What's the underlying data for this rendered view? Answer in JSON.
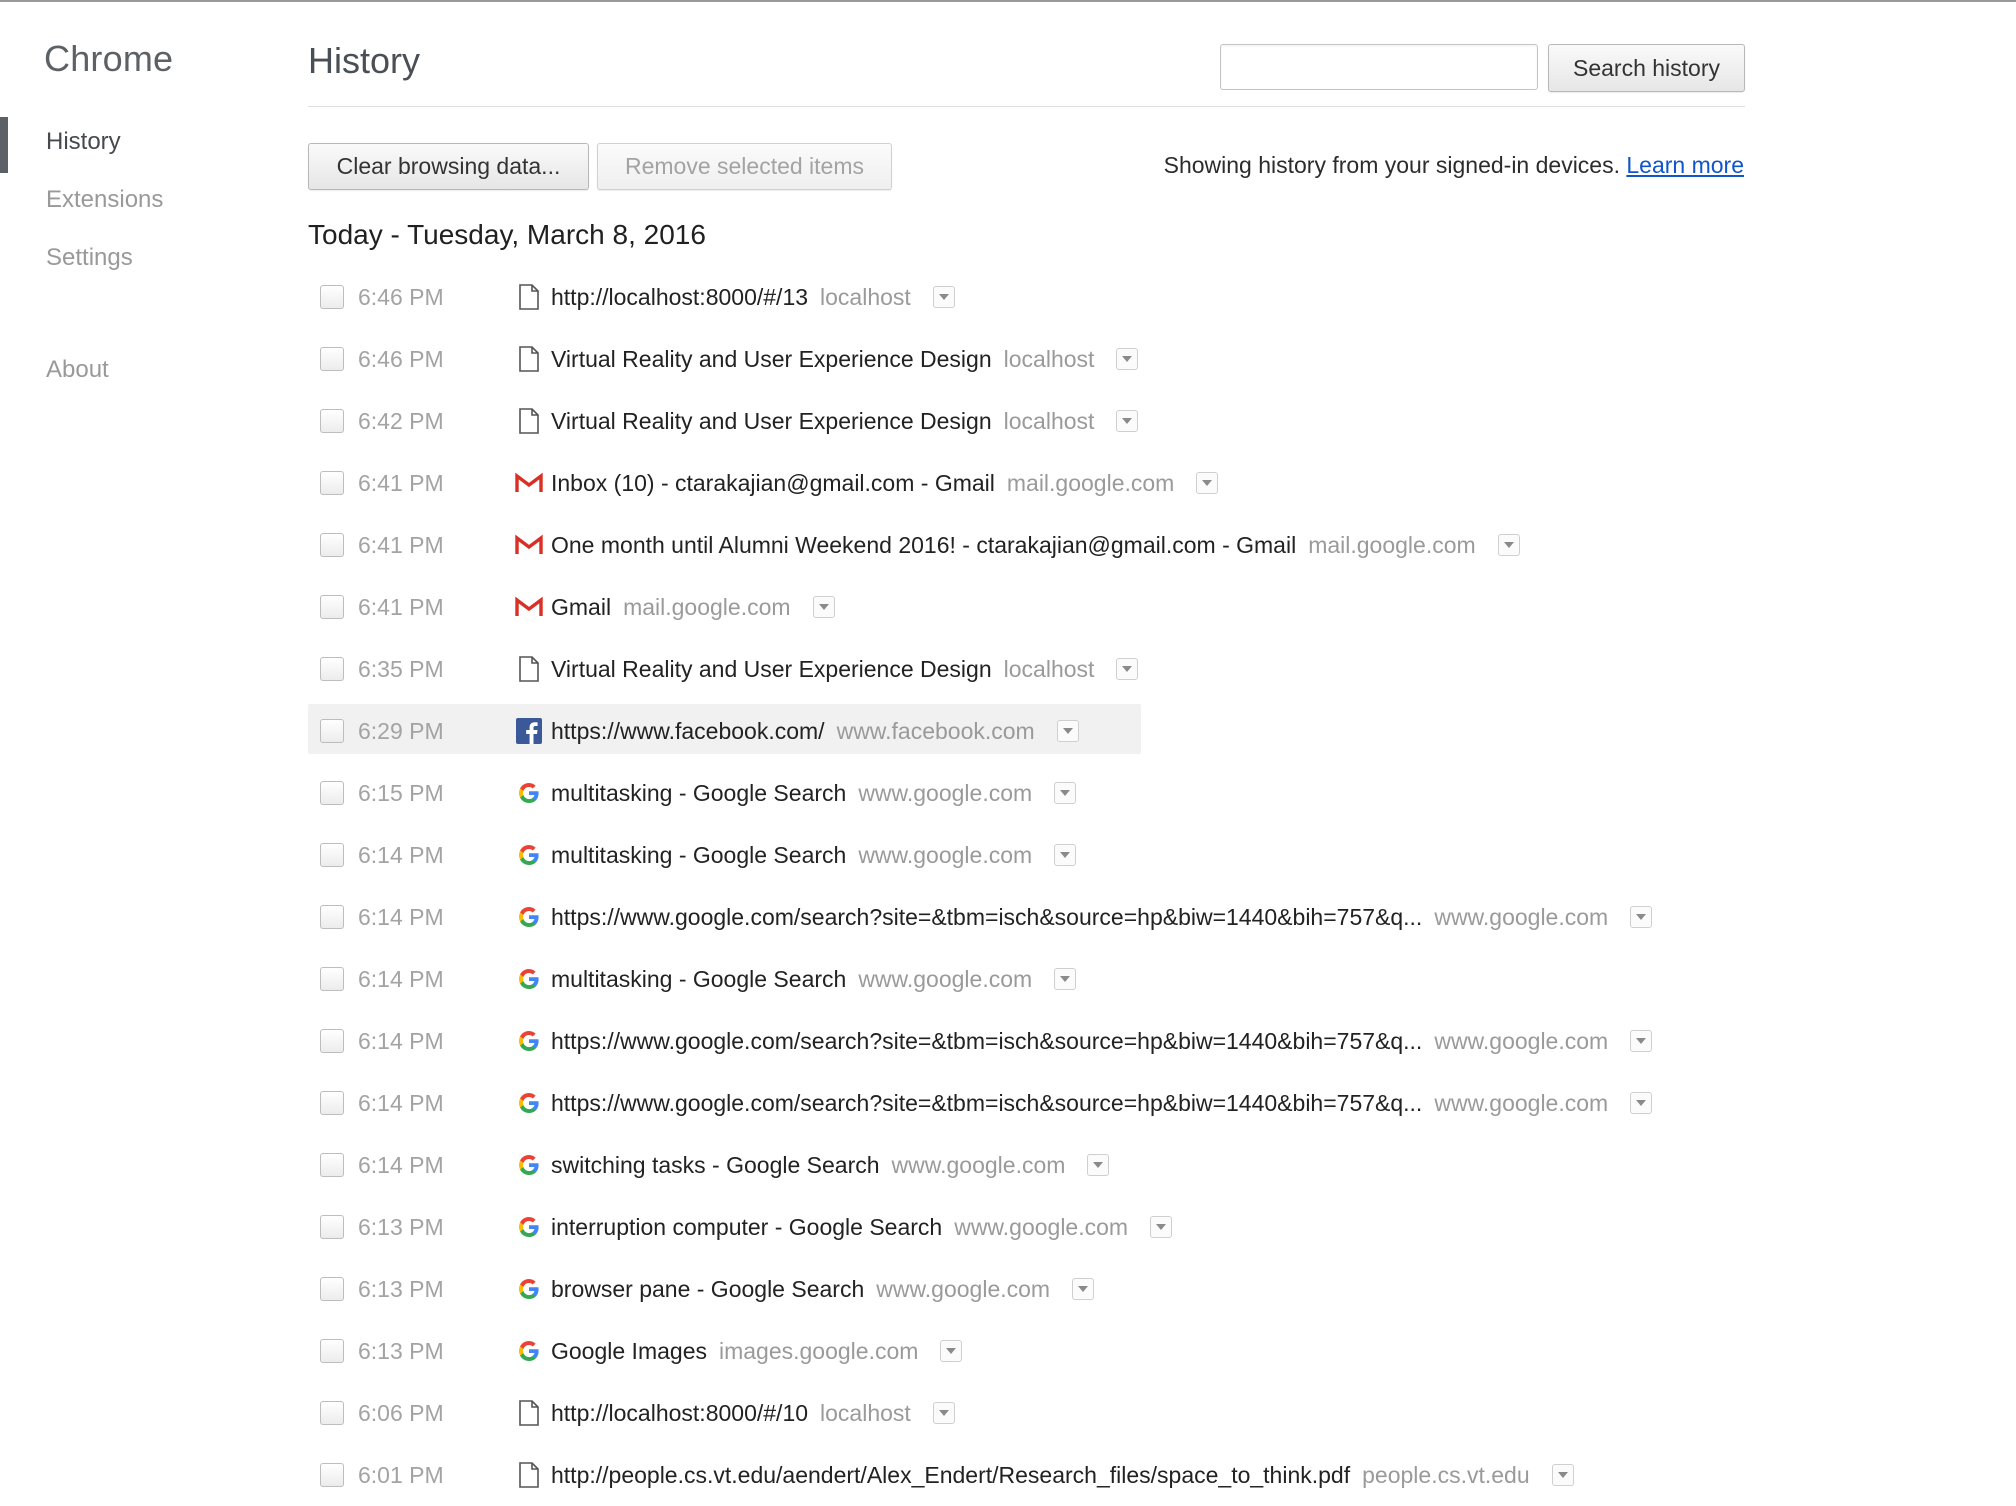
{
  "sidebar": {
    "brand": "Chrome",
    "items": [
      {
        "label": "History",
        "active": true
      },
      {
        "label": "Extensions"
      },
      {
        "label": "Settings"
      },
      {
        "label": "About"
      }
    ]
  },
  "header": {
    "title": "History",
    "search_placeholder": "",
    "search_button": "Search history"
  },
  "toolbar": {
    "clear_label": "Clear browsing data...",
    "remove_label": "Remove selected items",
    "signed_in_text": "Showing history from your signed-in devices.",
    "learn_more": "Learn more"
  },
  "day_heading": "Today - Tuesday, March 8, 2016",
  "colors": {
    "link": "#1155cc",
    "gmail_red": "#d93025",
    "facebook_blue": "#3b5998"
  },
  "rows": [
    {
      "time": "6:46 PM",
      "title": "http://localhost:8000/#/13",
      "domain": "localhost",
      "icon": "page-icon"
    },
    {
      "time": "6:46 PM",
      "title": "Virtual Reality and User Experience Design",
      "domain": "localhost",
      "icon": "page-icon"
    },
    {
      "time": "6:42 PM",
      "title": "Virtual Reality and User Experience Design",
      "domain": "localhost",
      "icon": "page-icon"
    },
    {
      "time": "6:41 PM",
      "title": "Inbox (10) - ctarakajian@gmail.com - Gmail",
      "domain": "mail.google.com",
      "icon": "gmail-icon"
    },
    {
      "time": "6:41 PM",
      "title": "One month until Alumni Weekend 2016! - ctarakajian@gmail.com - Gmail",
      "domain": "mail.google.com",
      "icon": "gmail-icon"
    },
    {
      "time": "6:41 PM",
      "title": "Gmail",
      "domain": "mail.google.com",
      "icon": "gmail-icon"
    },
    {
      "time": "6:35 PM",
      "title": "Virtual Reality and User Experience Design",
      "domain": "localhost",
      "icon": "page-icon"
    },
    {
      "time": "6:29 PM",
      "title": "https://www.facebook.com/",
      "domain": "www.facebook.com",
      "icon": "facebook-icon",
      "hovered": true
    },
    {
      "time": "6:15 PM",
      "title": "multitasking - Google Search",
      "domain": "www.google.com",
      "icon": "google-icon"
    },
    {
      "time": "6:14 PM",
      "title": "multitasking - Google Search",
      "domain": "www.google.com",
      "icon": "google-icon"
    },
    {
      "time": "6:14 PM",
      "title": "https://www.google.com/search?site=&tbm=isch&source=hp&biw=1440&bih=757&q...",
      "domain": "www.google.com",
      "icon": "google-icon"
    },
    {
      "time": "6:14 PM",
      "title": "multitasking - Google Search",
      "domain": "www.google.com",
      "icon": "google-icon"
    },
    {
      "time": "6:14 PM",
      "title": "https://www.google.com/search?site=&tbm=isch&source=hp&biw=1440&bih=757&q...",
      "domain": "www.google.com",
      "icon": "google-icon"
    },
    {
      "time": "6:14 PM",
      "title": "https://www.google.com/search?site=&tbm=isch&source=hp&biw=1440&bih=757&q...",
      "domain": "www.google.com",
      "icon": "google-icon"
    },
    {
      "time": "6:14 PM",
      "title": "switching tasks - Google Search",
      "domain": "www.google.com",
      "icon": "google-icon"
    },
    {
      "time": "6:13 PM",
      "title": "interruption computer - Google Search",
      "domain": "www.google.com",
      "icon": "google-icon"
    },
    {
      "time": "6:13 PM",
      "title": "browser pane - Google Search",
      "domain": "www.google.com",
      "icon": "google-icon"
    },
    {
      "time": "6:13 PM",
      "title": "Google Images",
      "domain": "images.google.com",
      "icon": "google-icon"
    },
    {
      "time": "6:06 PM",
      "title": "http://localhost:8000/#/10",
      "domain": "localhost",
      "icon": "page-icon"
    },
    {
      "time": "6:01 PM",
      "title": "http://people.cs.vt.edu/aendert/Alex_Endert/Research_files/space_to_think.pdf",
      "domain": "people.cs.vt.edu",
      "icon": "page-icon"
    }
  ]
}
